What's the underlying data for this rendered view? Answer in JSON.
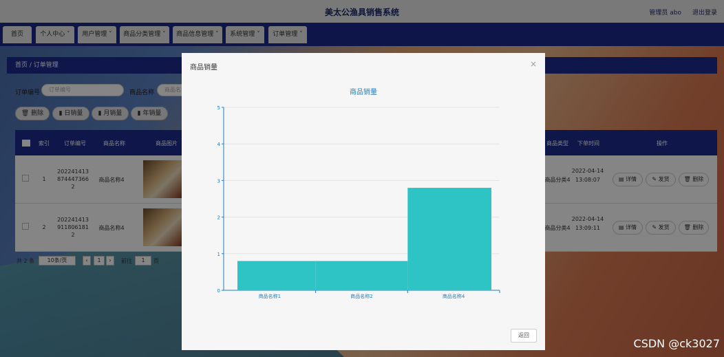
{
  "header": {
    "title": "美太公渔具销售系统",
    "admin_label": "管理员 abo",
    "logout_label": "退出登录"
  },
  "nav": [
    "首页",
    "个人中心",
    "用户管理",
    "商品分类管理",
    "商品信息管理",
    "系统管理",
    "订单管理"
  ],
  "breadcrumb": "首页 / 订单管理",
  "filters": {
    "order_label": "订单编号",
    "order_placeholder": "订单编号",
    "product_label": "商品名称",
    "product_placeholder": "商品名称"
  },
  "actions": [
    "删除",
    "日销量",
    "月销量",
    "年销量"
  ],
  "table": {
    "headers": [
      "索引",
      "订单编号",
      "商品名称",
      "商品图片",
      "商品类型",
      "下单时间",
      "操作"
    ],
    "rows": [
      {
        "index": "1",
        "order_no": "2022414138744473662",
        "name": "商品名称4",
        "type": "商品分类4",
        "time": "2022-04-14 13:08:07"
      },
      {
        "index": "2",
        "order_no": "2022414139118061812",
        "name": "商品名称4",
        "type": "商品分类4",
        "time": "2022-04-14 13:09:11"
      }
    ],
    "op_buttons": [
      "详情",
      "发货",
      "删除"
    ]
  },
  "pager": {
    "total": "共 2 条",
    "page_size": "10条/页",
    "page": "1",
    "goto_label": "前往",
    "goto_page": "1",
    "page_unit": "页"
  },
  "modal": {
    "title": "商品销量",
    "close": "×",
    "return_label": "返回"
  },
  "chart_data": {
    "type": "bar",
    "title": "商品销量",
    "categories": [
      "商品名称1",
      "商品名称2",
      "商品名称4"
    ],
    "values": [
      0.8,
      0.8,
      2.8
    ],
    "ylim": [
      0,
      5
    ],
    "yticks": [
      0,
      1,
      2,
      3,
      4,
      5
    ],
    "bar_color": "#2ec4c6",
    "axis_color": "#1e7fbf"
  },
  "watermark": "CSDN @ck3027"
}
